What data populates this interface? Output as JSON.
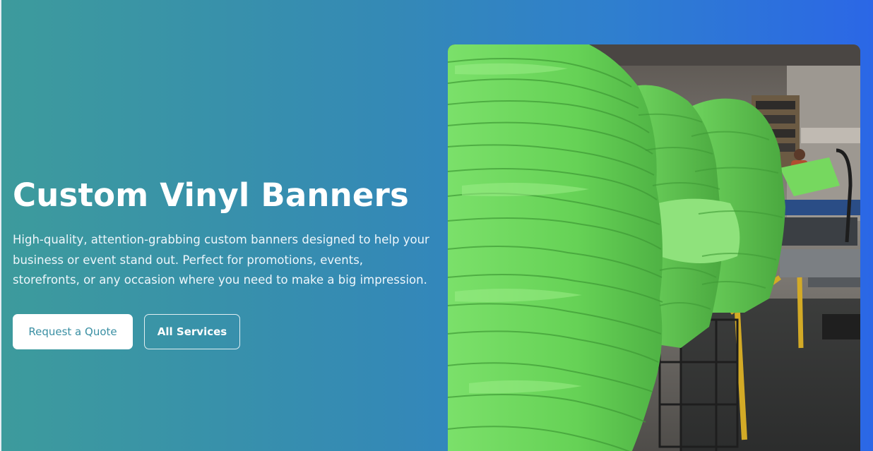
{
  "hero": {
    "title": "Custom Vinyl Banners",
    "description": "High-quality, attention-grabbing custom banners designed to help your business or event stand out. Perfect for promotions, events, storefronts, or any occasion where you need to make a big impression.",
    "primary_button": "Request a Quote",
    "secondary_button": "All Services"
  },
  "photo": {
    "subject": "stacks of green t-shirts in a screen printing shop"
  },
  "colors": {
    "gradient_start": "#3d9b9c",
    "gradient_end": "#2b67e6",
    "shirt_green": "#6ed65a",
    "primary_button_text": "#3a8fa3"
  }
}
